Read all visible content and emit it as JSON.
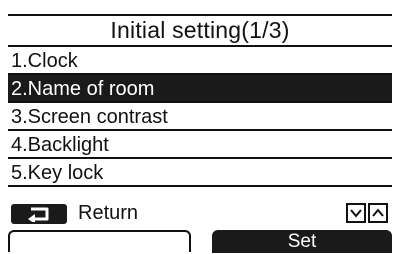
{
  "header": {
    "title": "Initial setting(1/3)"
  },
  "menu": {
    "items": [
      {
        "label": "1.Clock",
        "selected": false
      },
      {
        "label": "2.Name of room",
        "selected": true
      },
      {
        "label": "3.Screen contrast",
        "selected": false
      },
      {
        "label": "4.Backlight",
        "selected": false
      },
      {
        "label": "5.Key lock",
        "selected": false
      }
    ]
  },
  "footer": {
    "return_icon": "return-arrow-icon",
    "return_label": "Return",
    "scroll_down_icon": "chevron-down-icon",
    "scroll_up_icon": "chevron-up-icon",
    "left_softkey_label": "",
    "right_softkey_label": "Set"
  }
}
